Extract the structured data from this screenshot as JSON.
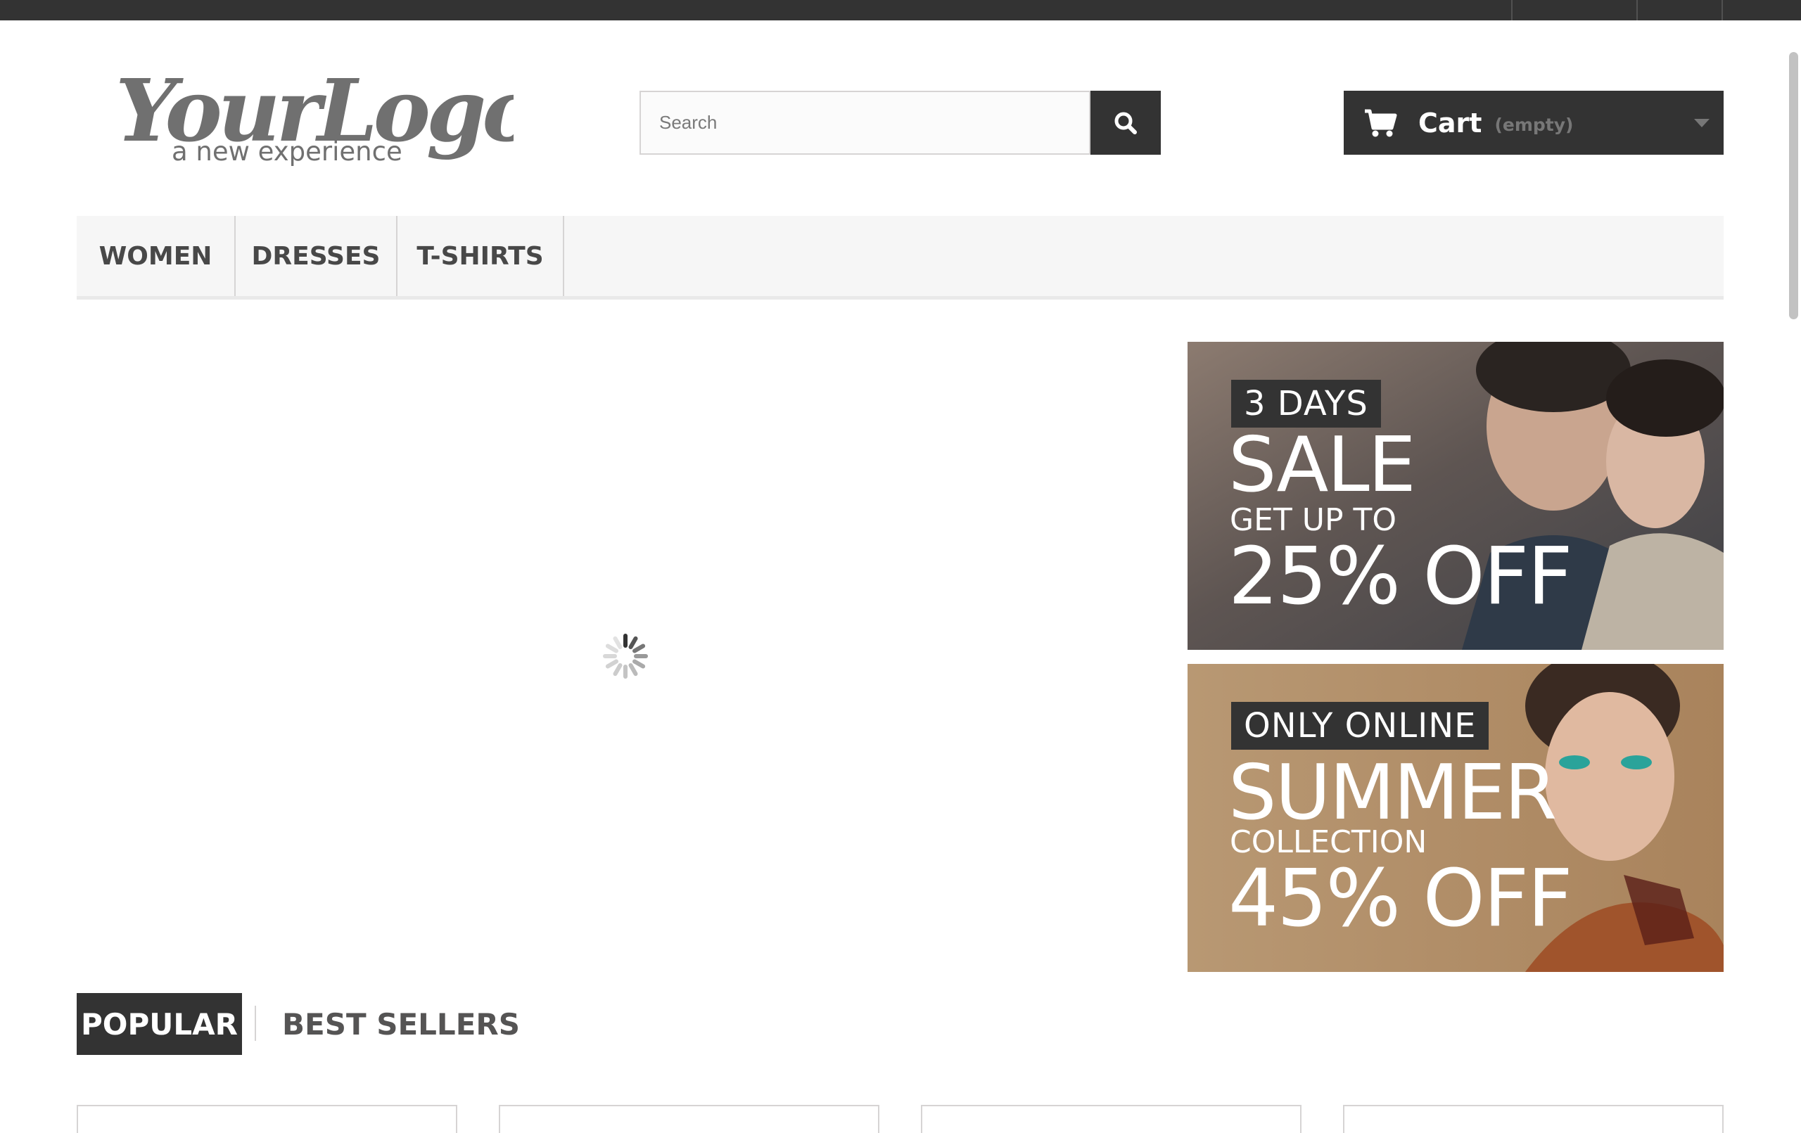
{
  "header": {
    "logo": {
      "brand": "YourLogo",
      "tagline": "a new experience"
    },
    "search": {
      "placeholder": "Search"
    },
    "cart": {
      "label": "Cart",
      "status": "(empty)"
    }
  },
  "menu": {
    "items": [
      {
        "label": "WOMEN"
      },
      {
        "label": "DRESSES"
      },
      {
        "label": "T-SHIRTS"
      }
    ]
  },
  "banners": [
    {
      "tag": "3 DAYS",
      "headline": "SALE",
      "subline": "GET UP TO",
      "offer": "25% OFF"
    },
    {
      "tag": "ONLY ONLINE",
      "headline": "SUMMER",
      "subline": "COLLECTION",
      "offer": "45% OFF"
    }
  ],
  "tabs": [
    {
      "label": "POPULAR",
      "active": true
    },
    {
      "label": "BEST SELLERS",
      "active": false
    }
  ],
  "colors": {
    "dark": "#333333",
    "menu_bg": "#f6f6f6",
    "border": "#d6d4d4",
    "banner1_bg": "#5a5451",
    "banner2_bg": "#b08c66"
  },
  "icons": {
    "search": "search-icon",
    "cart": "cart-icon",
    "dropdown": "chevron-down-icon",
    "loading": "loading-spinner-icon"
  }
}
